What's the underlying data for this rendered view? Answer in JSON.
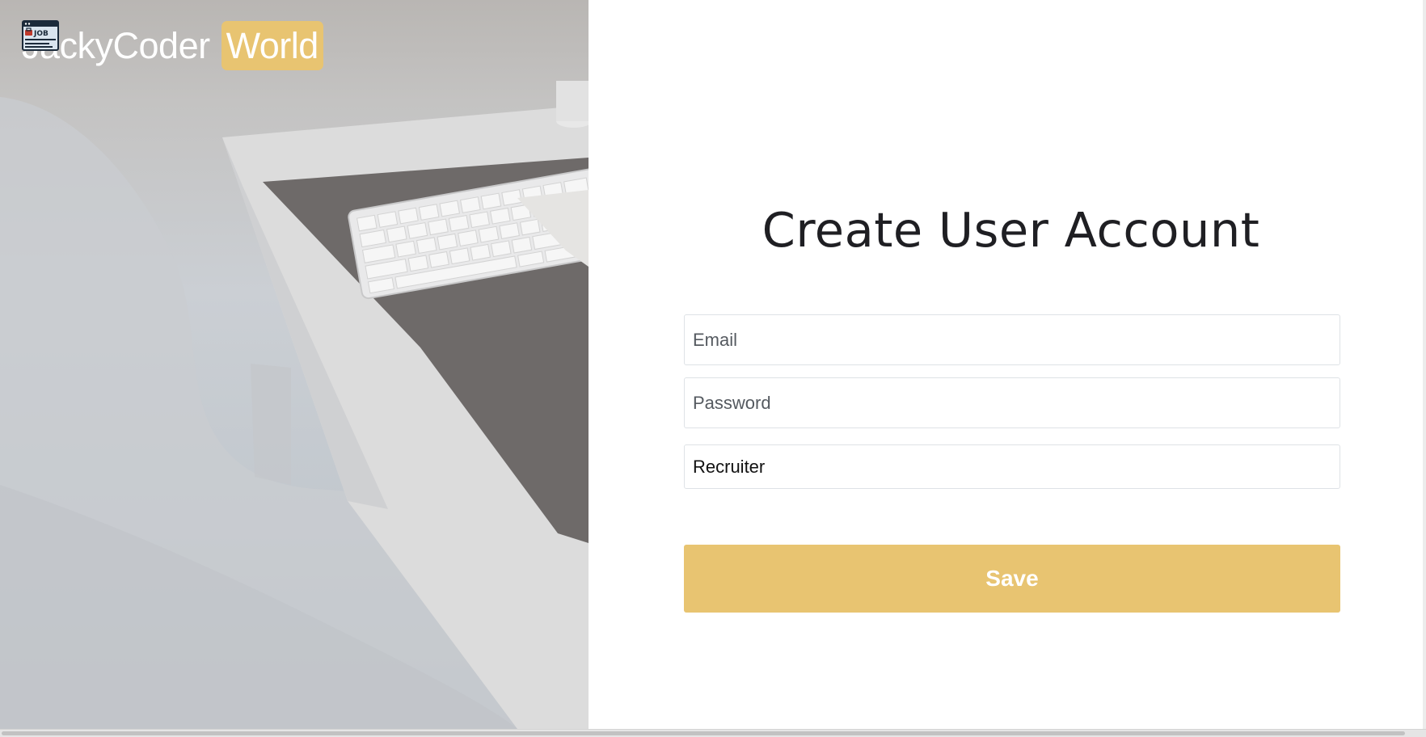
{
  "brand": {
    "name": "JackyCoder",
    "highlight": "World",
    "logo_icon": "job-listing-icon",
    "logo_text": "JOB",
    "accent_color": "#e8c471"
  },
  "form": {
    "title": "Create User Account",
    "email_placeholder": "Email",
    "password_placeholder": "Password",
    "role_selected": "Recruiter",
    "save_label": "Save"
  }
}
